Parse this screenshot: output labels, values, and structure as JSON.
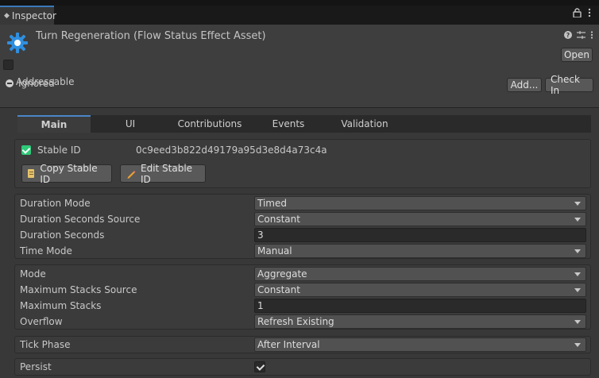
{
  "window": {
    "tab_label": "Inspector",
    "tab_icon": "inspector-icon",
    "header_icons": [
      "lock-icon",
      "kebab-menu-icon"
    ]
  },
  "asset": {
    "title": "Turn Regeneration (Flow Status Effect Asset)",
    "icon": "gear-asset-icon",
    "open_label": "Open",
    "addressable_label": "Addressable",
    "ignored_label": "Ignored",
    "add_label": "Add...",
    "checkin_label": "Check In",
    "header_icons": [
      "help-icon",
      "settings-icon",
      "kebab-menu-icon"
    ]
  },
  "tabs": [
    {
      "label": "Main",
      "active": true
    },
    {
      "label": "UI",
      "active": false
    },
    {
      "label": "Contributions",
      "active": false
    },
    {
      "label": "Events",
      "active": false
    },
    {
      "label": "Validation",
      "active": false
    }
  ],
  "stable_id": {
    "label": "Stable ID",
    "value": "0c9eed3b822d49179a95d3e8d4a73c4a",
    "checked": true,
    "copy_label": "Copy Stable ID",
    "edit_label": "Edit Stable ID"
  },
  "duration": {
    "mode_label": "Duration Mode",
    "mode_value": "Timed",
    "seconds_source_label": "Duration Seconds Source",
    "seconds_source_value": "Constant",
    "seconds_label": "Duration Seconds",
    "seconds_value": "3",
    "time_mode_label": "Time Mode",
    "time_mode_value": "Manual"
  },
  "stacking": {
    "mode_label": "Mode",
    "mode_value": "Aggregate",
    "max_source_label": "Maximum Stacks Source",
    "max_source_value": "Constant",
    "max_label": "Maximum Stacks",
    "max_value": "1",
    "overflow_label": "Overflow",
    "overflow_value": "Refresh Existing"
  },
  "tick": {
    "phase_label": "Tick Phase",
    "phase_value": "After Interval"
  },
  "persist": {
    "label": "Persist",
    "checked": true
  },
  "colors": {
    "accent": "#4a86c8",
    "check_green": "#2fc979",
    "asset_icon": "#2f8fe0"
  }
}
